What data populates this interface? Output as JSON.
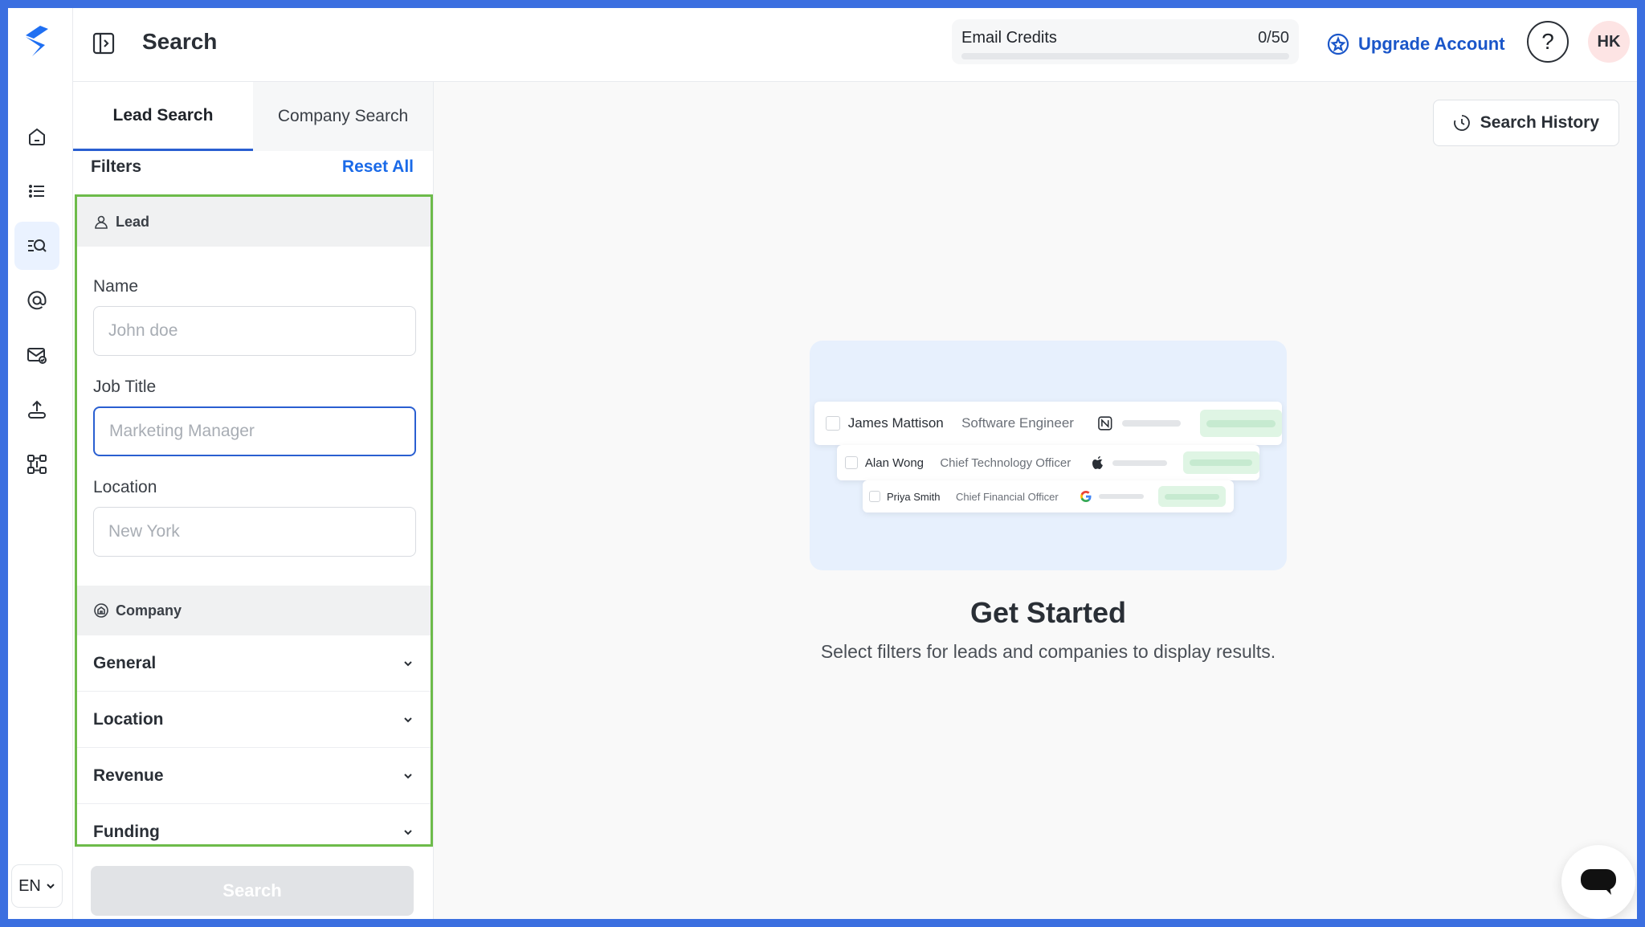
{
  "header": {
    "title": "Search",
    "credits_label": "Email Credits",
    "credits_value": "0/50",
    "credits_fraction": 0,
    "upgrade_label": "Upgrade Account",
    "help_symbol": "?",
    "avatar_initials": "HK"
  },
  "rail": {
    "items": [
      "home-icon",
      "list-icon",
      "lead-search-icon",
      "at-icon",
      "mail-verify-icon",
      "upload-icon",
      "integrations-icon"
    ],
    "active": "lead-search-icon",
    "language": "EN"
  },
  "panel": {
    "tabs": [
      {
        "label": "Lead Search",
        "active": true
      },
      {
        "label": "Company Search",
        "active": false
      }
    ],
    "filters_label": "Filters",
    "reset_label": "Reset All",
    "lead_section": "Lead",
    "fields": [
      {
        "label": "Name",
        "placeholder": "John doe"
      },
      {
        "label": "Job Title",
        "placeholder": "Marketing Manager"
      },
      {
        "label": "Location",
        "placeholder": "New York"
      }
    ],
    "company_section": "Company",
    "accordions": [
      "General",
      "Location",
      "Revenue",
      "Funding"
    ],
    "search_label": "Search"
  },
  "main": {
    "history_label": "Search History",
    "preview_rows": [
      {
        "name": "James Mattison",
        "title": "Software Engineer",
        "logo": "notion-logo"
      },
      {
        "name": "Alan Wong",
        "title": "Chief Technology Officer",
        "logo": "apple-logo"
      },
      {
        "name": "Priya Smith",
        "title": "Chief Financial Officer",
        "logo": "google-logo"
      }
    ],
    "get_started": "Get Started",
    "subtitle": "Select filters for leads and companies to display results."
  },
  "colors": {
    "accent": "#2a5fd1",
    "link": "#1a6ae8",
    "highlight_border": "#6dbb4a",
    "rail_active_bg": "#eaf2ff"
  }
}
